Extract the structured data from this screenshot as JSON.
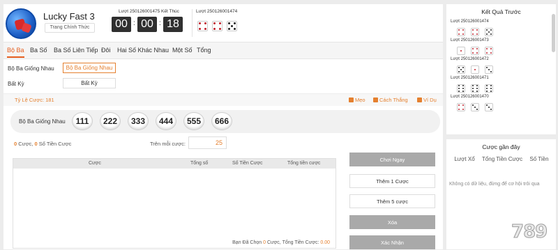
{
  "header": {
    "game_title": "Lucky Fast 3",
    "subtitle_button": "Trang Chính Thức",
    "current_round_label": "Lượt 250126001475 Kết Thúc",
    "timer": {
      "hours": "00",
      "minutes": "00",
      "seconds": "18"
    },
    "previous_round_label": "Lượt 250126001474",
    "previous_dice": [
      4,
      4,
      5
    ]
  },
  "tabs": [
    {
      "label": "Bộ Ba",
      "active": true
    },
    {
      "label": "Ba Số"
    },
    {
      "label": "Ba Số Liên Tiếp"
    },
    {
      "label": "Đôi"
    },
    {
      "label": "Hai Số Khác Nhau"
    },
    {
      "label": "Một Số"
    },
    {
      "label": "Tổng"
    }
  ],
  "subtabs": {
    "row1_label": "Bộ Ba Giống Nhau",
    "row1_button": "Bộ Ba Giống Nhau",
    "row2_label": "Bất Kỳ",
    "row2_button": "Bất Kỳ"
  },
  "odds": {
    "rate": "Tỷ Lệ Cược: 181",
    "links": [
      "Mẹo",
      "Cách Thắng",
      "Ví Dụ"
    ]
  },
  "bet": {
    "label": "Bộ Ba Giống Nhau",
    "options": [
      "111",
      "222",
      "333",
      "444",
      "555",
      "666"
    ]
  },
  "summary": {
    "bets_count": "0",
    "bets_text": " Cược, ",
    "amount": "0",
    "amount_text": " Số Tiền Cược",
    "per_bet_label": "Trên mỗi cược:",
    "per_bet_value": "25"
  },
  "table": {
    "headers": [
      "Cược",
      "Tổng số",
      "Số Tiền Cược",
      "Tổng tiền cược"
    ],
    "footer_prefix": "Bạn Đã Chọn ",
    "footer_count": "0",
    "footer_mid": " Cược, Tổng Tiền Cược: ",
    "footer_total": "0.00"
  },
  "actions": {
    "play_now": "Chơi Ngay",
    "add_one": "Thêm 1 Cược",
    "add_five": "Thêm 5 cược",
    "delete": "Xóa",
    "confirm": "Xác Nhận"
  },
  "results": {
    "title": "Kết Quả Trước",
    "rounds": [
      {
        "label": "Lượt 250126001474",
        "dice": [
          4,
          4,
          5
        ]
      },
      {
        "label": "Lượt 250126001473",
        "dice": [
          1,
          4,
          4
        ]
      },
      {
        "label": "Lượt 250126001472",
        "dice": [
          5,
          1,
          3
        ]
      },
      {
        "label": "Lượt 250126001471",
        "dice": [
          6,
          6,
          6
        ]
      },
      {
        "label": "Lượt 250126001470",
        "dice": [
          4,
          3,
          3
        ]
      }
    ]
  },
  "recent": {
    "title": "Cược gần đây",
    "headers": [
      "Lượt Xổ",
      "Tổng Tiền Cược",
      "Số Tiền"
    ],
    "empty": "Không có dữ liệu, đừng để cơ hội trôi qua"
  },
  "watermark": "789"
}
